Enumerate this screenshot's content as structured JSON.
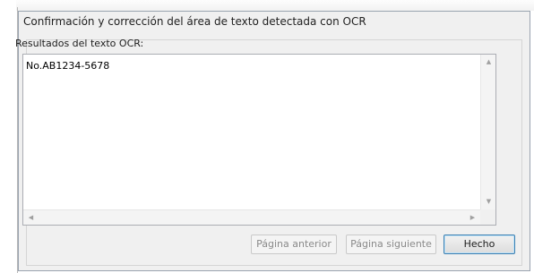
{
  "dialog": {
    "title": "Confirmación y corrección del área de texto detectada con OCR",
    "results_label": "Resultados del texto OCR:",
    "ocr_text": "No.AB1234-5678"
  },
  "buttons": {
    "previous_page": "Página anterior",
    "next_page": "Página siguiente",
    "done": "Hecho"
  }
}
